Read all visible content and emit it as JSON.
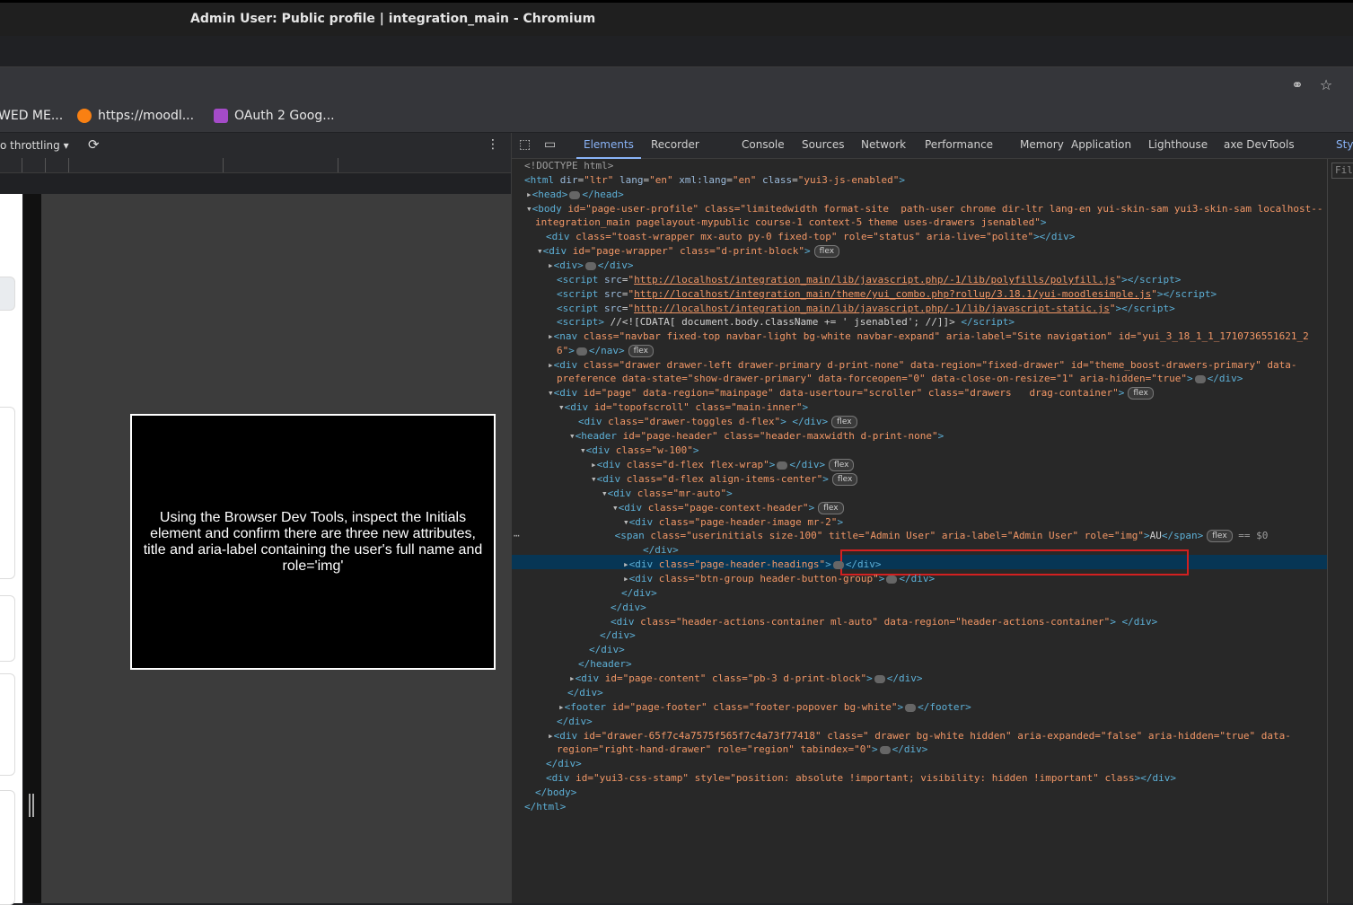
{
  "window": {
    "title": "Admin User: Public profile | integration_main - Chromium"
  },
  "bookmarks": [
    {
      "label": "WED ME...",
      "color": "#35363a"
    },
    {
      "label": "https://moodl...",
      "color": "#f98012"
    },
    {
      "label": "OAuth 2 Goog...",
      "color": "#a44bc8"
    }
  ],
  "device_toolbar": {
    "throttling": "o throttling"
  },
  "overlay": {
    "text": "Using the Browser Dev Tools, inspect the Initials element and confirm there are three new attributes, title and aria-label containing the user's full name and role='img'"
  },
  "devtools": {
    "tabs": [
      "Elements",
      "Recorder",
      "Console",
      "Sources",
      "Network",
      "Performance",
      "Memory",
      "Application",
      "Lighthouse",
      "axe DevTools"
    ],
    "styles_pane": {
      "title": "Styl",
      "filter": "Filt"
    }
  },
  "dom": {
    "doctype": "<!DOCTYPE html>",
    "html_open": {
      "tag": "html",
      "attrs": [
        [
          "dir",
          "ltr"
        ],
        [
          "lang",
          "en"
        ],
        [
          "xml:lang",
          "en"
        ],
        [
          "class",
          "yui3-js-enabled"
        ]
      ]
    },
    "head": "head",
    "body_attrs_1": "id=\"page-user-profile\" class=\"limitedwidth format-site  path-user chrome dir-ltr lang-en yui-skin-sam yui3-skin-sam localhost--",
    "body_attrs_2": "integration_main pagelayout-mypublic course-1 context-5 theme uses-drawers jsenabled\"",
    "toast": "class=\"toast-wrapper mx-auto py-0 fixed-top\" role=\"status\" aria-live=\"polite\"",
    "page_wrapper": "id=\"page-wrapper\" class=\"d-print-block\"",
    "script1": "http://localhost/integration_main/lib/javascript.php/-1/lib/polyfills/polyfill.js",
    "script2": "http://localhost/integration_main/theme/yui_combo.php?rollup/3.18.1/yui-moodlesimple.js",
    "script3": "http://localhost/integration_main/lib/javascript.php/-1/lib/javascript-static.js",
    "script4": "//<![CDATA[ document.body.className += ' jsenabled'; //]]>",
    "nav_1": "class=\"navbar fixed-top navbar-light bg-white navbar-expand\" aria-label=\"Site navigation\" id=\"yui_3_18_1_1_1710736551621_2",
    "nav_2": "6\"",
    "drawer_1": "class=\"drawer drawer-left drawer-primary d-print-none\" data-region=\"fixed-drawer\" id=\"theme_boost-drawers-primary\" data-",
    "drawer_2": "preference data-state=\"show-drawer-primary\" data-forceopen=\"0\" data-close-on-resize=\"1\" aria-hidden=\"true\"",
    "page": "id=\"page\" data-region=\"mainpage\" data-usertour=\"scroller\" class=\"drawers   drag-container\"",
    "topofscroll": "id=\"topofscroll\" class=\"main-inner\"",
    "drawer_toggles": "class=\"drawer-toggles d-flex\"",
    "page_header": "id=\"page-header\" class=\"header-maxwidth d-print-none\"",
    "w100": "class=\"w-100\"",
    "flexwrap": "class=\"d-flex flex-wrap\"",
    "align_center": "class=\"d-flex align-items-center\"",
    "mr_auto": "class=\"mr-auto\"",
    "context_header": "class=\"page-context-header\"",
    "header_image": "class=\"page-header-image mr-2\"",
    "span_selected": "class=\"userinitials size-100\" title=\"Admin User\" aria-label=\"Admin User\" role=\"img\"",
    "span_text": "AU",
    "header_headings": "class=\"page-header-headings\"",
    "btn_group": "class=\"btn-group header-button-group\"",
    "header_actions": "class=\"header-actions-container ml-auto\" data-region=\"header-actions-container\"",
    "page_content": "id=\"page-content\" class=\"pb-3 d-print-block\"",
    "footer": "id=\"page-footer\" class=\"footer-popover bg-white\"",
    "drawer_right_1": "id=\"drawer-65f7c4a7575f565f7c4a73f77418\" class=\" drawer bg-white hidden\" aria-expanded=\"false\" aria-hidden=\"true\" data-",
    "drawer_right_2": "region=\"right-hand-drawer\" role=\"region\" tabindex=\"0\"",
    "css_stamp": "id=\"yui3-css-stamp\" style=\"position: absolute !important; visibility: hidden !important\" class",
    "badge_flex": "flex",
    "eq_sign": "== $0"
  }
}
